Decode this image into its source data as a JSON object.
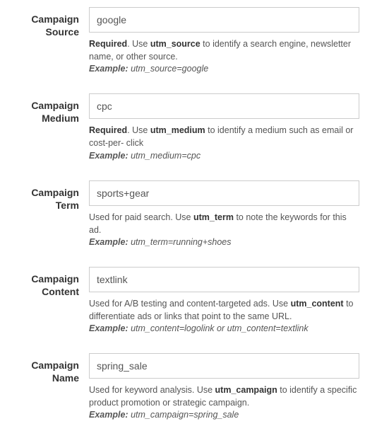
{
  "fields": [
    {
      "label": "Campaign Source",
      "value": "google",
      "help_prefix": "Required",
      "help_pre": ". Use ",
      "help_param": "utm_source",
      "help_post": " to identify a search engine, newsletter name, or other source.",
      "example_label": "Example:",
      "example_value": " utm_source=google"
    },
    {
      "label": "Campaign Medium",
      "value": "cpc",
      "help_prefix": "Required",
      "help_pre": ". Use ",
      "help_param": "utm_medium",
      "help_post": " to identify a medium such as email or cost-per- click",
      "example_label": "Example:",
      "example_value": " utm_medium=cpc"
    },
    {
      "label": "Campaign Term",
      "value": "sports+gear",
      "help_prefix": "",
      "help_pre": "Used for paid search. Use ",
      "help_param": "utm_term",
      "help_post": " to note the keywords for this ad.",
      "example_label": "Example:",
      "example_value": " utm_term=running+shoes"
    },
    {
      "label": "Campaign Content",
      "value": "textlink",
      "help_prefix": "",
      "help_pre": "Used for A/B testing and content-targeted ads. Use ",
      "help_param": "utm_content",
      "help_post": " to differentiate ads or links that point to the same URL.",
      "example_label": "Example:",
      "example_value": " utm_content=logolink ",
      "example_or": "or",
      "example_value2": " utm_content=textlink"
    },
    {
      "label": "Campaign Name",
      "value": "spring_sale",
      "help_prefix": "",
      "help_pre": "Used for keyword analysis. Use ",
      "help_param": "utm_campaign",
      "help_post": " to identify a specific product promotion or strategic campaign.",
      "example_label": "Example:",
      "example_value": " utm_campaign=spring_sale"
    }
  ]
}
